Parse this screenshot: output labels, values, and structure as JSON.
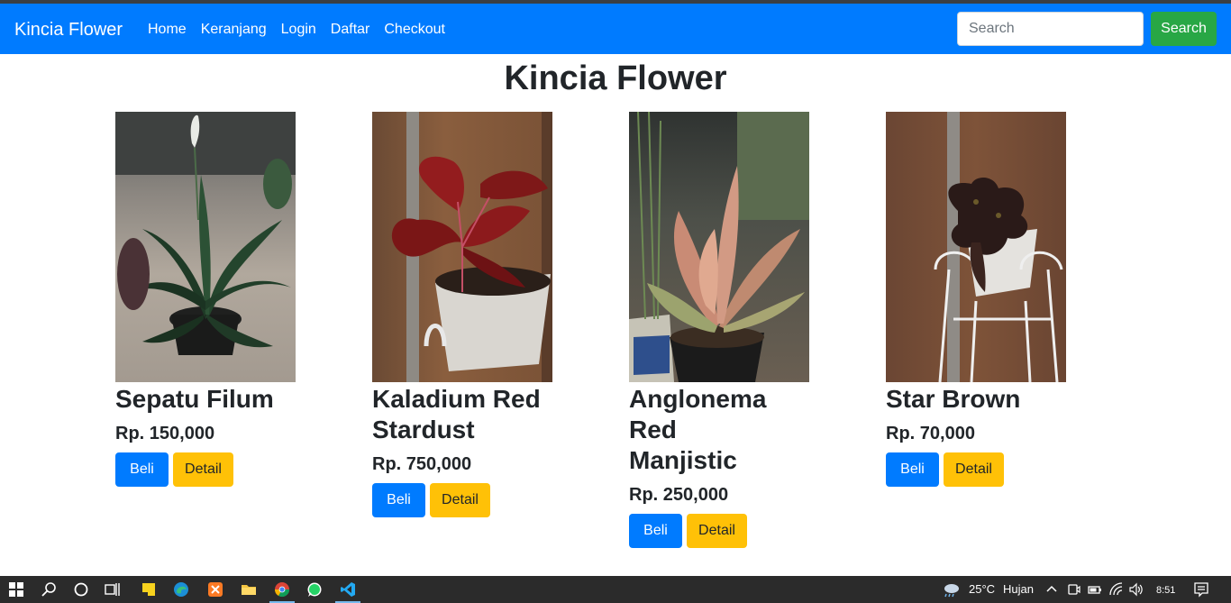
{
  "navbar": {
    "brand": "Kincia Flower",
    "links": [
      "Home",
      "Keranjang",
      "Login",
      "Daftar",
      "Checkout"
    ],
    "search_placeholder": "Search",
    "search_button": "Search",
    "color": "#007bff"
  },
  "page": {
    "title": "Kincia Flower"
  },
  "products": [
    {
      "name_line1": "Sepatu Filum",
      "name_line2": "",
      "price": "Rp. 150,000",
      "buy_label": "Beli",
      "detail_label": "Detail"
    },
    {
      "name_line1": "Kaladium Red",
      "name_line2": "Stardust",
      "price": "Rp. 750,000",
      "buy_label": "Beli",
      "detail_label": "Detail"
    },
    {
      "name_line1": "Anglonema Red",
      "name_line2": "Manjistic",
      "price": "Rp. 250,000",
      "buy_label": "Beli",
      "detail_label": "Detail"
    },
    {
      "name_line1": "Star Brown",
      "name_line2": "",
      "price": "Rp. 70,000",
      "buy_label": "Beli",
      "detail_label": "Detail"
    }
  ],
  "colors": {
    "buy": "#007bff",
    "detail": "#ffc107",
    "search": "#28a745"
  },
  "taskbar": {
    "icons": [
      "windows-start-icon",
      "search-icon",
      "cortana-icon",
      "task-view-icon",
      "sticky-notes-icon",
      "edge-icon",
      "xampp-icon",
      "file-explorer-icon",
      "chrome-icon",
      "whatsapp-icon",
      "vscode-icon"
    ],
    "weather_temp": "25°C",
    "weather_text": "Hujan",
    "time": "8:51"
  }
}
